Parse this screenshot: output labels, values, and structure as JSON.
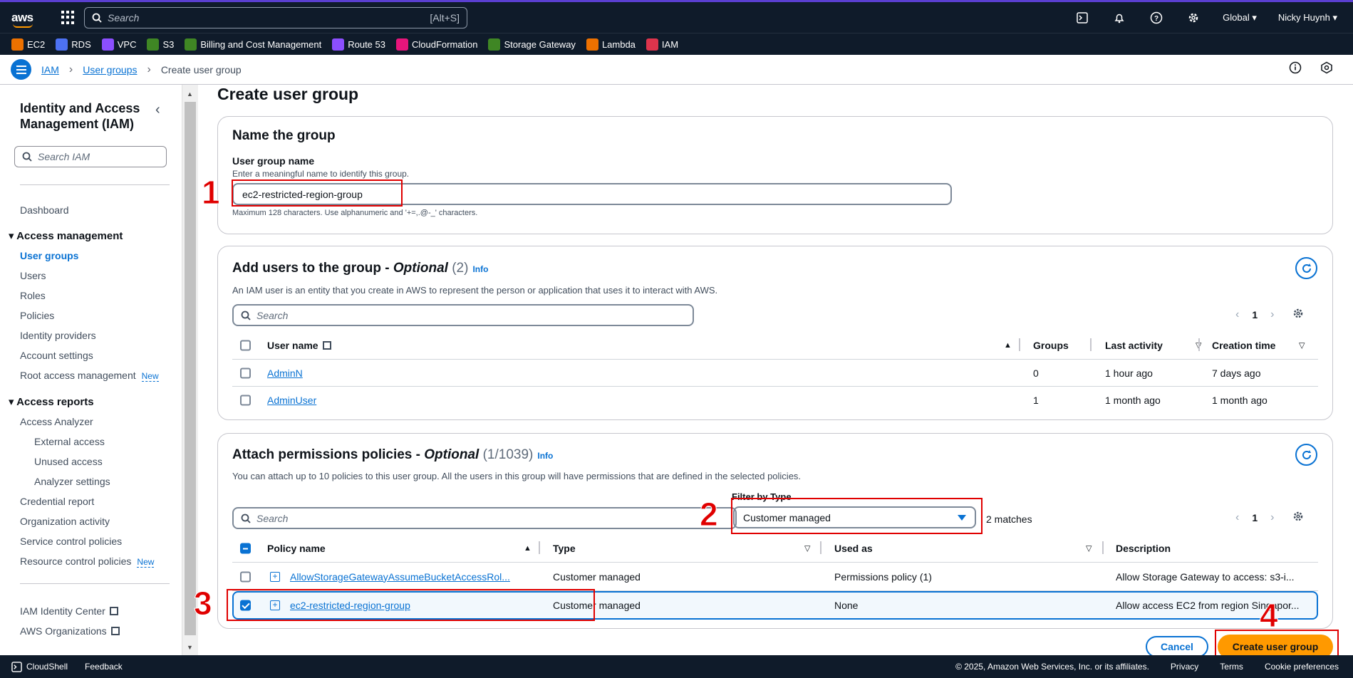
{
  "topnav": {
    "search_placeholder": "Search",
    "search_shortcut": "[Alt+S]",
    "region": "Global",
    "user": "Nicky Huynh"
  },
  "favorites": [
    {
      "label": "EC2",
      "color": "#ed7100"
    },
    {
      "label": "RDS",
      "color": "#4d72f3"
    },
    {
      "label": "VPC",
      "color": "#8c4fff"
    },
    {
      "label": "S3",
      "color": "#3f8624"
    },
    {
      "label": "Billing and Cost Management",
      "color": "#3f8624"
    },
    {
      "label": "Route 53",
      "color": "#8c4fff"
    },
    {
      "label": "CloudFormation",
      "color": "#e7157b"
    },
    {
      "label": "Storage Gateway",
      "color": "#3f8624"
    },
    {
      "label": "Lambda",
      "color": "#ed7100"
    },
    {
      "label": "IAM",
      "color": "#dd344c"
    }
  ],
  "breadcrumb": {
    "items": [
      "IAM",
      "User groups"
    ],
    "current": "Create user group"
  },
  "sidebar": {
    "title": "Identity and Access Management (IAM)",
    "search_placeholder": "Search IAM",
    "dashboard": "Dashboard",
    "access_management": "Access management",
    "am_items": [
      "User groups",
      "Users",
      "Roles",
      "Policies",
      "Identity providers",
      "Account settings",
      "Root access management"
    ],
    "access_reports": "Access reports",
    "access_analyzer": "Access Analyzer",
    "analyzer_subitems": [
      "External access",
      "Unused access",
      "Analyzer settings"
    ],
    "ar_items": [
      "Credential report",
      "Organization activity",
      "Service control policies",
      "Resource control policies"
    ],
    "new_badge": "New",
    "identity_center": "IAM Identity Center",
    "organizations": "AWS Organizations"
  },
  "page": {
    "title": "Create user group"
  },
  "name_group": {
    "heading": "Name the group",
    "label": "User group name",
    "description": "Enter a meaningful name to identify this group.",
    "value": "ec2-restricted-region-group",
    "constraint": "Maximum 128 characters. Use alphanumeric and '+=,.@-_' characters."
  },
  "add_users": {
    "heading": "Add users to the group - ",
    "heading_optional": "Optional",
    "count": "(2)",
    "info": "Info",
    "description": "An IAM user is an entity that you create in AWS to represent the person or application that uses it to interact with AWS.",
    "search_placeholder": "Search",
    "page": "1",
    "columns": [
      "User name",
      "Groups",
      "Last activity",
      "Creation time"
    ],
    "rows": [
      {
        "name": "AdminN",
        "groups": "0",
        "last_activity": "1 hour ago",
        "created": "7 days ago"
      },
      {
        "name": "AdminUser",
        "groups": "1",
        "last_activity": "1 month ago",
        "created": "1 month ago"
      }
    ]
  },
  "policies": {
    "heading": "Attach permissions policies - ",
    "heading_optional": "Optional",
    "count": "(1/1039)",
    "info": "Info",
    "description": "You can attach up to 10 policies to this user group. All the users in this group will have permissions that are defined in the selected policies.",
    "search_placeholder": "Search",
    "filter_label": "Filter by Type",
    "filter_value": "Customer managed",
    "matches": "2 matches",
    "page": "1",
    "columns": [
      "Policy name",
      "Type",
      "Used as",
      "Description"
    ],
    "rows": [
      {
        "name": "AllowStorageGatewayAssumeBucketAccessRol...",
        "type": "Customer managed",
        "used_as": "Permissions policy (1)",
        "description": "Allow Storage Gateway to access: s3-i...",
        "checked": false
      },
      {
        "name": "ec2-restricted-region-group",
        "type": "Customer managed",
        "used_as": "None",
        "description": "Allow access EC2 from region Singapor...",
        "checked": true
      }
    ]
  },
  "actions": {
    "cancel": "Cancel",
    "create": "Create user group"
  },
  "markers": [
    "1",
    "2",
    "3",
    "4"
  ],
  "footer": {
    "cloudshell": "CloudShell",
    "feedback": "Feedback",
    "copyright": "© 2025, Amazon Web Services, Inc. or its affiliates.",
    "privacy": "Privacy",
    "terms": "Terms",
    "cookies": "Cookie preferences"
  },
  "colors": {
    "accent": "#0972d3",
    "primary_button": "#ff9900",
    "annotation": "#e00000",
    "nav_bg": "#0f1b2a"
  }
}
